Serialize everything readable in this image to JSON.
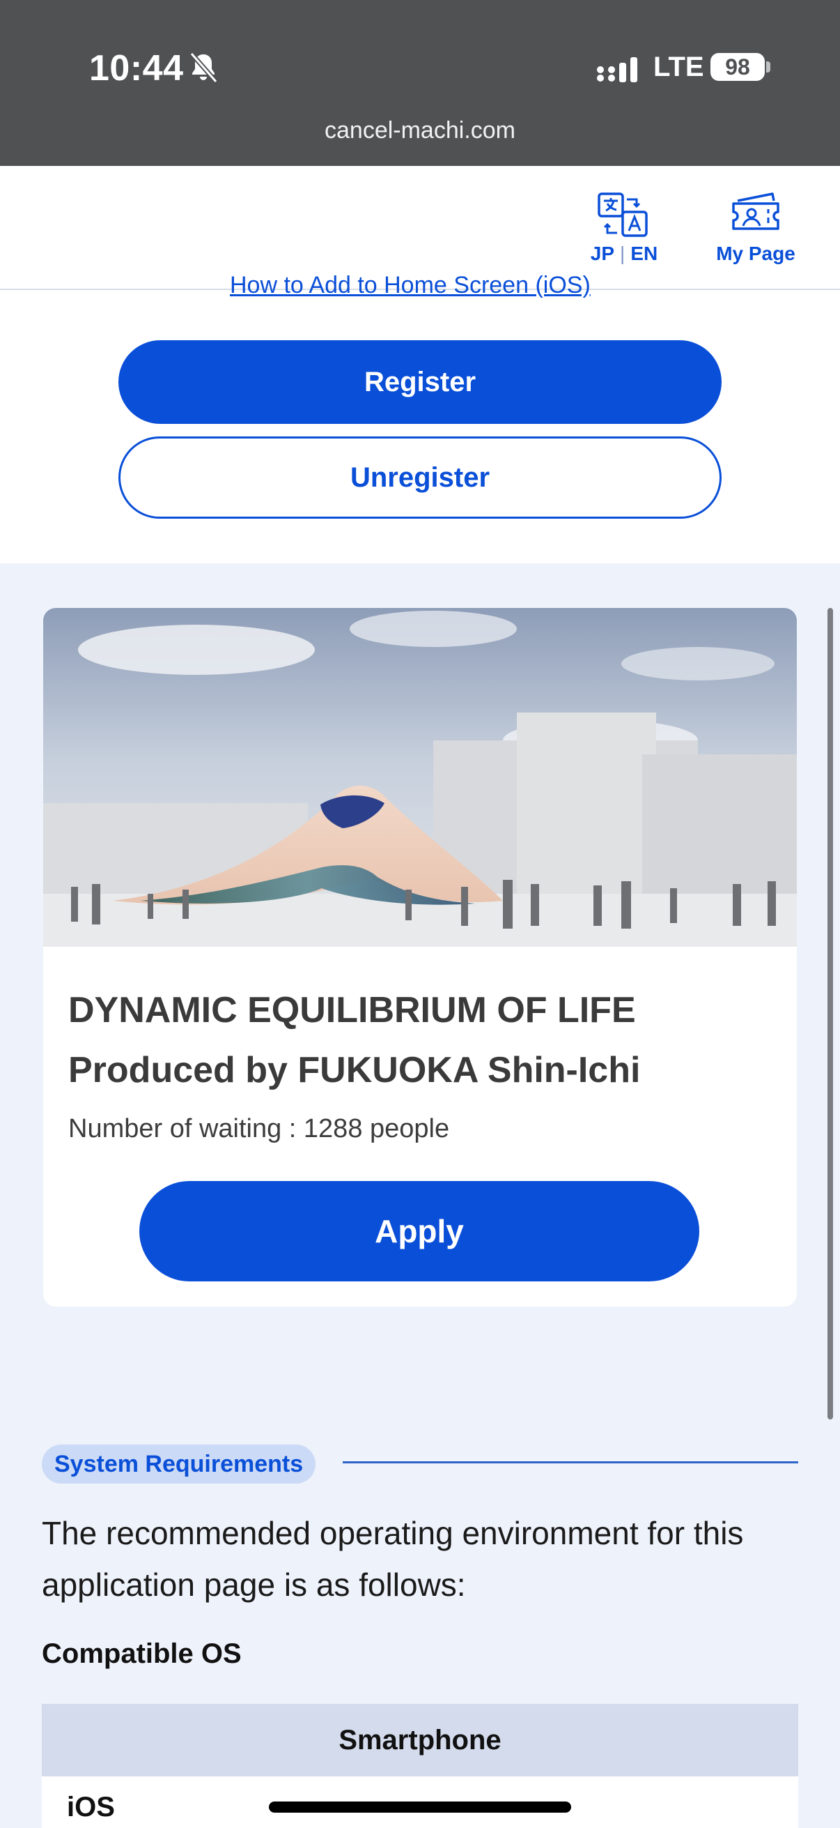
{
  "status_bar": {
    "time": "10:44",
    "network": "LTE",
    "battery": "98",
    "icons": [
      "bell-off-icon",
      "signal-icon",
      "battery-icon"
    ]
  },
  "browser": {
    "url": "cancel-machi.com"
  },
  "header": {
    "lang_jp": "JP",
    "lang_separator": "|",
    "lang_en": "EN",
    "my_page": "My Page",
    "icons": [
      "translate-icon",
      "ticket-user-icon"
    ]
  },
  "register_section": {
    "partial_link": "How to Add to Home Screen (iOS)",
    "register_label": "Register",
    "unregister_label": "Unregister"
  },
  "pavilion_card": {
    "title_line1": "DYNAMIC EQUILIBRIUM OF LIFE",
    "title_line2": "Produced by FUKUOKA Shin-Ichi",
    "waiting_text": "Number of waiting : 1288 people",
    "apply_label": "Apply"
  },
  "system_requirements": {
    "badge": "System Requirements",
    "description": "The recommended operating environment for this application page is as follows:",
    "compatible_os_heading": "Compatible OS",
    "table": {
      "header": "Smartphone",
      "rows": [
        {
          "label": "iOS"
        }
      ]
    }
  },
  "colors": {
    "primary": "#0a4fd8",
    "page_background": "#eef2fb",
    "status_bar": "#4f5153",
    "badge_background": "#cbdaf6",
    "table_header": "#d3dbec"
  }
}
